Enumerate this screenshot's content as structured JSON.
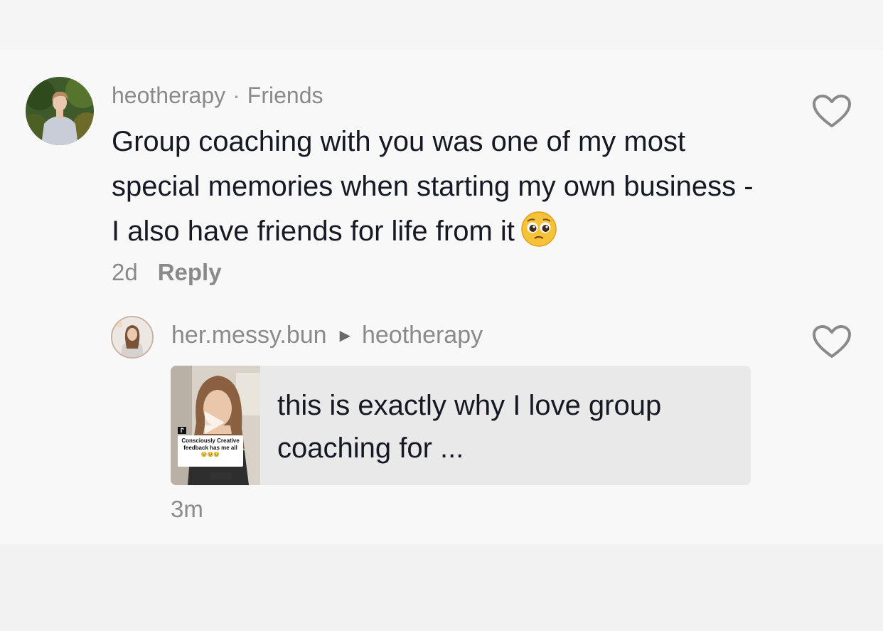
{
  "comment": {
    "username": "heotherapy",
    "separator": "·",
    "relation": "Friends",
    "text": "Group coaching with you was one of my most special memories when starting my own business - I also have friends for life from it",
    "emoji": "pleading-face-emoji",
    "age": "2d",
    "reply_label": "Reply"
  },
  "reply": {
    "username": "her.messy.bun",
    "arrow": "▶",
    "reply_to": "heotherapy",
    "thumbnail_caption": "Consciously Creative feedback has me all",
    "thumbnail_caption_emoji": "🥹🥹🥹",
    "text": "this is exactly why I love group coaching for ...",
    "age": "3m"
  },
  "icons": {
    "like": "heart-outline-icon",
    "play": "play-icon"
  },
  "colors": {
    "background": "#f8f8f8",
    "text_primary": "#161823",
    "text_secondary": "#8a8a8a",
    "card_background": "#e9e9e9"
  }
}
